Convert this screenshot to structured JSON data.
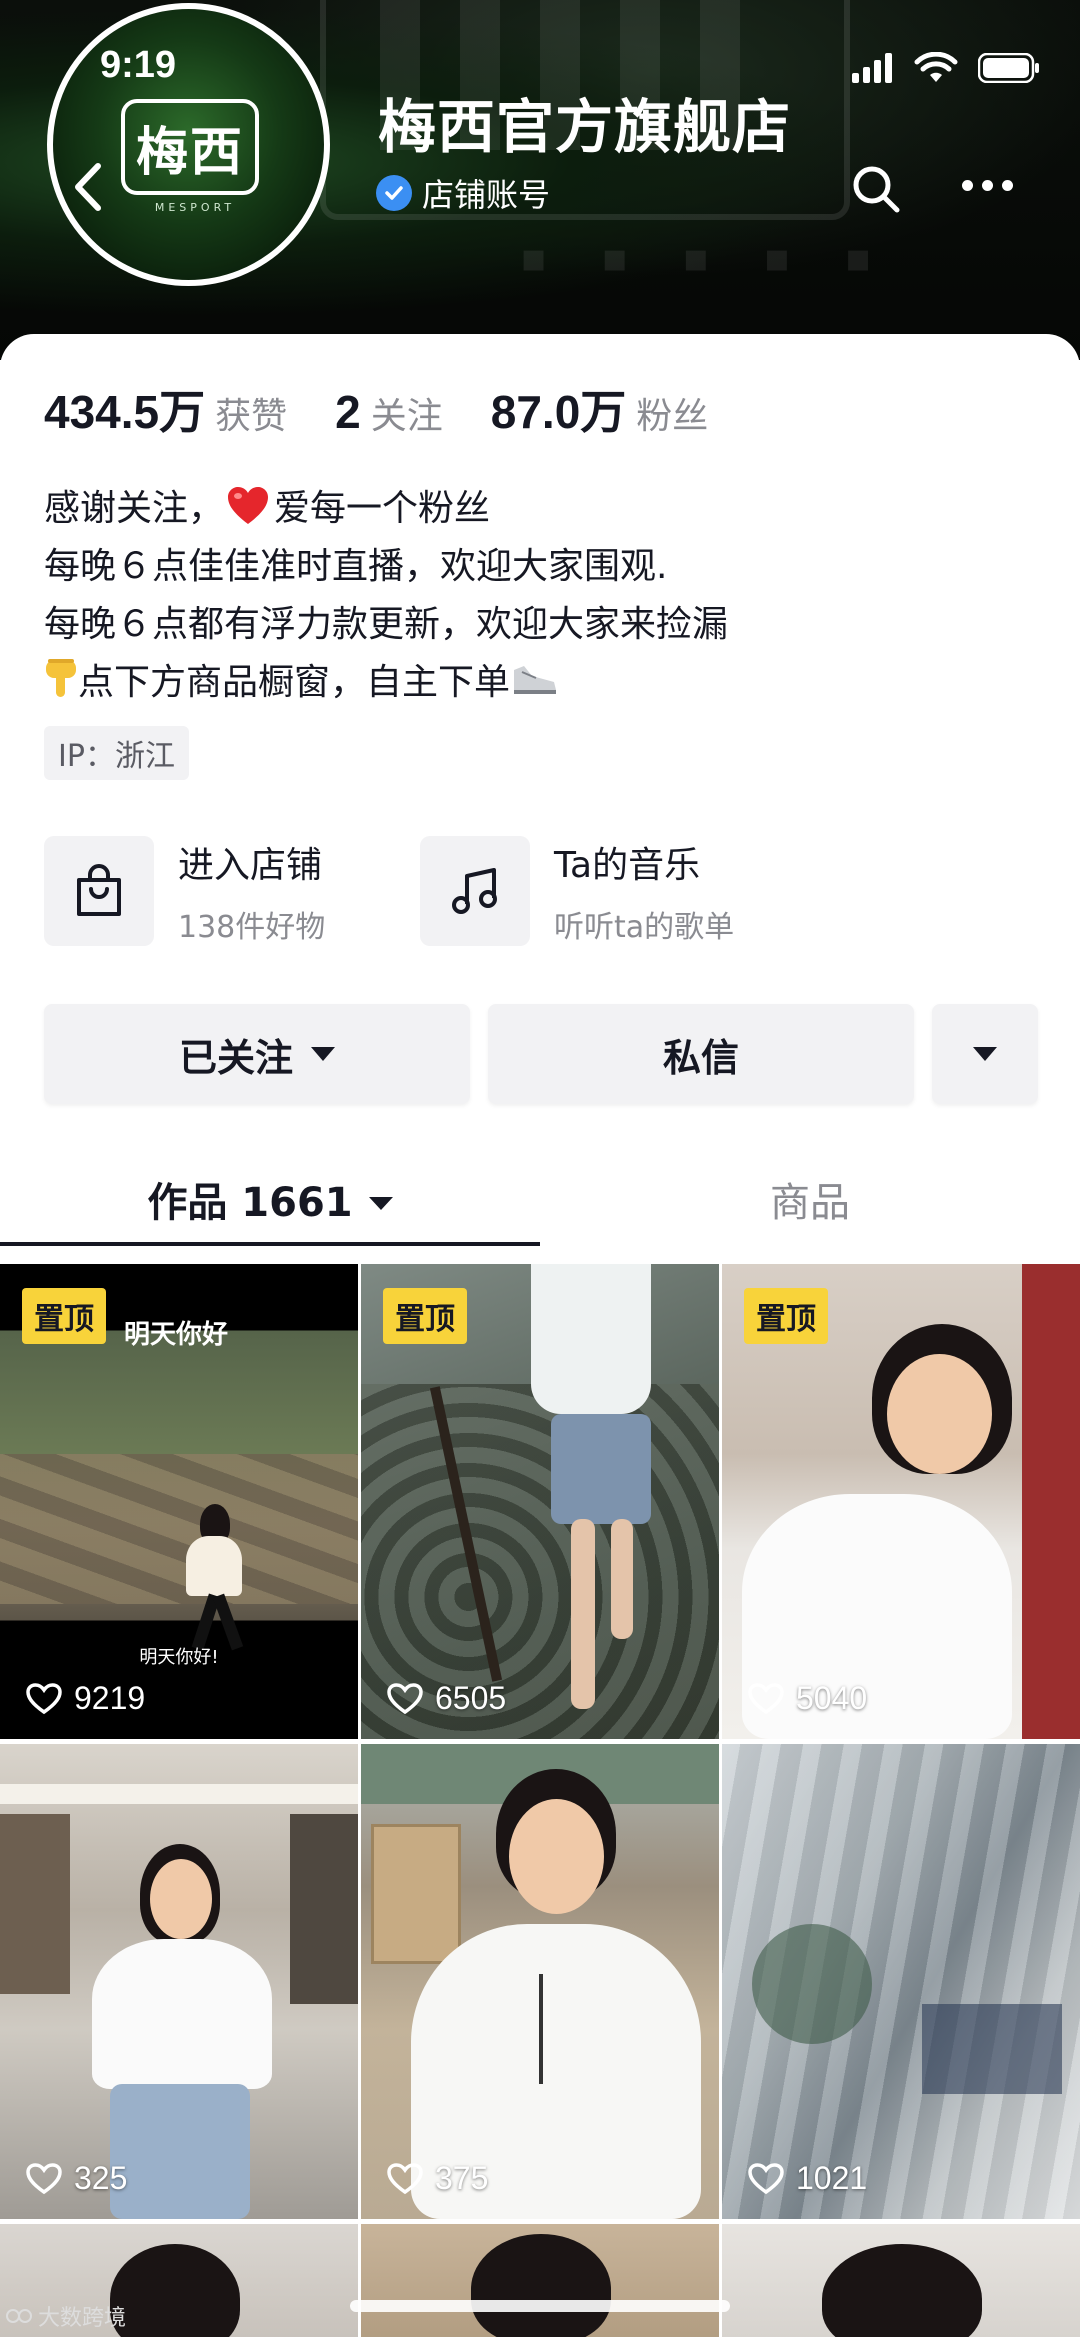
{
  "status_bar": {
    "time": "9:19"
  },
  "header": {
    "store_name": "梅西官方旗舰店",
    "account_type": "店铺账号",
    "avatar_logo": "梅西",
    "avatar_sub": "MESPORT"
  },
  "stats": [
    {
      "value": "434.5万",
      "label": "获赞"
    },
    {
      "value": "2",
      "label": "关注"
    },
    {
      "value": "87.0万",
      "label": "粉丝"
    }
  ],
  "bio": {
    "line1_prefix": "感谢关注，",
    "line1_suffix": "爱每一个粉丝",
    "line2": "每晚６点佳佳准时直播，欢迎大家围观.",
    "line3": "每晚６点都有浮力款更新，欢迎大家来捡漏",
    "line4": "点下方商品橱窗，自主下单"
  },
  "ip": "IP：浙江",
  "entries": {
    "shop": {
      "title": "进入店铺",
      "subtitle": "138件好物"
    },
    "music": {
      "title": "Ta的音乐",
      "subtitle": "听听ta的歌单"
    }
  },
  "actions": {
    "follow": "已关注",
    "message": "私信"
  },
  "tabs": {
    "works": "作品 1661",
    "goods": "商品"
  },
  "videos": [
    {
      "pinned": "置顶",
      "likes": "9219",
      "caption_top": "明天你好",
      "caption_bottom": "明天你好!"
    },
    {
      "pinned": "置顶",
      "likes": "6505"
    },
    {
      "pinned": "置顶",
      "likes": "5040"
    },
    {
      "likes": "325"
    },
    {
      "likes": "375"
    },
    {
      "likes": "1021"
    }
  ],
  "watermark": "大数跨境",
  "colors": {
    "pin": "#f8d33a",
    "verify": "#3b8ff3",
    "text_muted": "#8a8b91"
  }
}
